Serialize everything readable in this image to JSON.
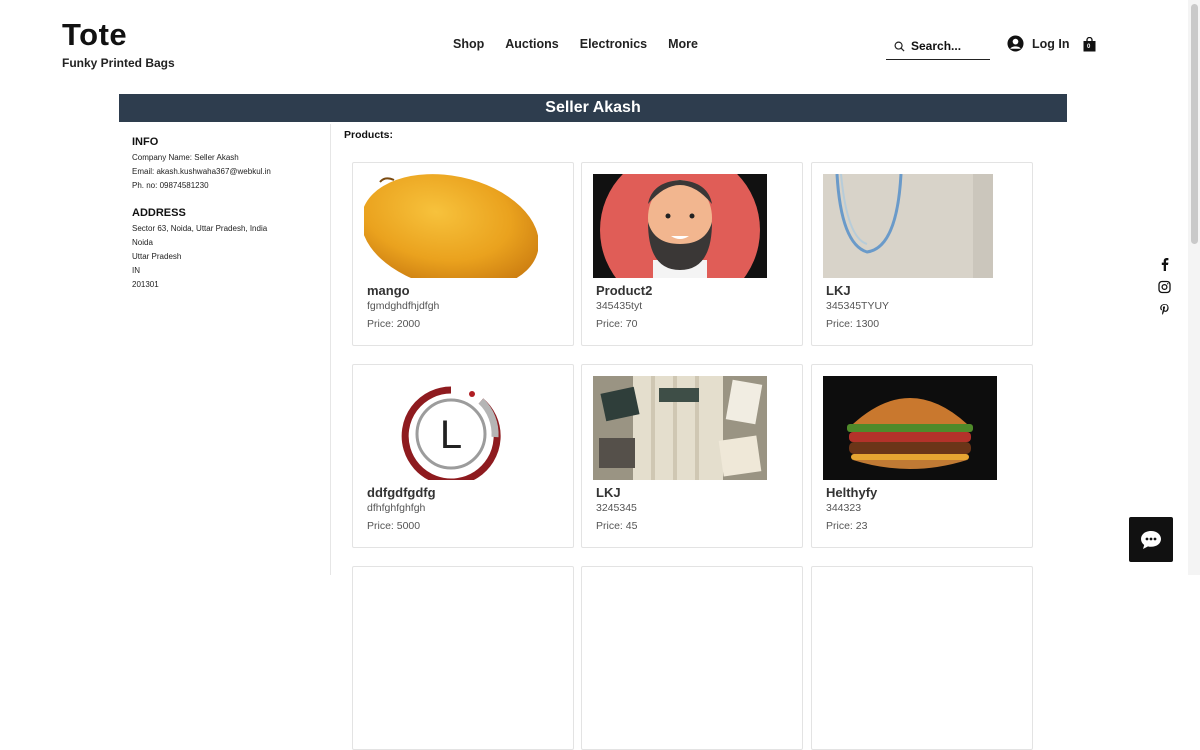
{
  "brand": {
    "title": "Tote",
    "subtitle": "Funky Printed Bags"
  },
  "nav": [
    "Shop",
    "Auctions",
    "Electronics",
    "More"
  ],
  "search": {
    "placeholder": "Search..."
  },
  "login": {
    "label": "Log In"
  },
  "cart": {
    "count": "0"
  },
  "seller": {
    "title": "Seller Akash"
  },
  "info": {
    "heading": "INFO",
    "company": "Company Name: Seller Akash",
    "email": "Email: akash.kushwaha367@webkul.in",
    "phone": "Ph. no: 09874581230"
  },
  "address": {
    "heading": "ADDRESS",
    "lines": [
      "Sector 63, Noida, Uttar Pradesh, India",
      "Noida",
      "Uttar Pradesh",
      "IN",
      "201301"
    ]
  },
  "products_label": "Products:",
  "products": [
    {
      "name": "mango",
      "sku": "fgmdghdfhjdfgh",
      "price": "Price: 2000"
    },
    {
      "name": "Product2",
      "sku": "345435tyt",
      "price": "Price: 70"
    },
    {
      "name": "LKJ",
      "sku": "345345TYUY",
      "price": "Price: 1300"
    },
    {
      "name": "ddfgdfgdfg",
      "sku": "dfhfghfghfgh",
      "price": "Price: 5000"
    },
    {
      "name": "LKJ",
      "sku": "3245345",
      "price": "Price: 45"
    },
    {
      "name": "Helthyfy",
      "sku": "344323",
      "price": "Price: 23"
    }
  ],
  "logo_letter": "L",
  "icons": [
    "search-icon",
    "user-icon",
    "shopping-bag-icon",
    "facebook-icon",
    "instagram-icon",
    "pinterest-icon",
    "chat-icon"
  ]
}
